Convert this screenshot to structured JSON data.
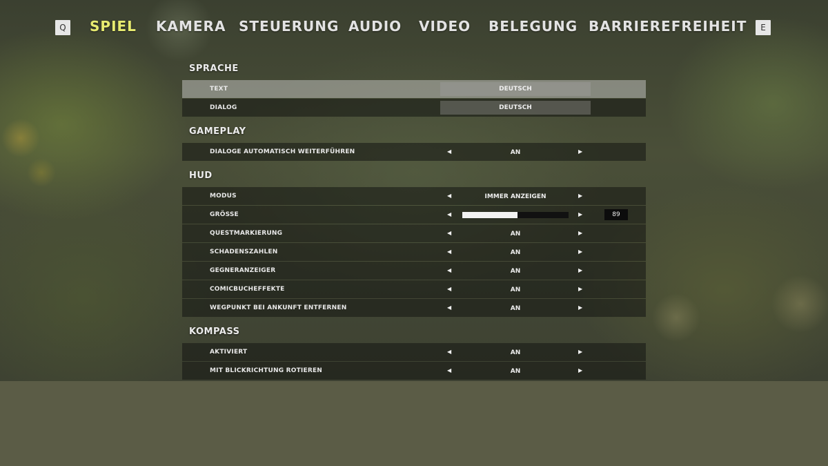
{
  "nav": {
    "prev_key": "Q",
    "next_key": "E",
    "tabs": [
      {
        "label": "Spiel",
        "active": true
      },
      {
        "label": "Kamera"
      },
      {
        "label": "Steuerung"
      },
      {
        "label": "Audio"
      },
      {
        "label": "Video"
      },
      {
        "label": "Belegung"
      },
      {
        "label": "Barrierefreiheit"
      }
    ]
  },
  "colors": {
    "active_tab": "#e8ec70",
    "text": "#e3e3e3"
  },
  "sections": {
    "sprache": {
      "title": "Sprache",
      "text": {
        "label": "Text",
        "value": "Deutsch"
      },
      "dialog": {
        "label": "Dialog",
        "value": "Deutsch"
      }
    },
    "gameplay": {
      "title": "Gameplay",
      "auto_dialog": {
        "label": "Dialoge automatisch weiterführen",
        "value": "An"
      }
    },
    "hud": {
      "title": "HUD",
      "modus": {
        "label": "Modus",
        "value": "Immer anzeigen"
      },
      "groesse": {
        "label": "Größe",
        "value": "89",
        "fraction": 0.52
      },
      "questmarkierung": {
        "label": "Questmarkierung",
        "value": "An"
      },
      "schadenszahlen": {
        "label": "Schadenszahlen",
        "value": "An"
      },
      "gegneranzeiger": {
        "label": "Gegneranzeiger",
        "value": "An"
      },
      "comicbucheffekte": {
        "label": "Comicbucheffekte",
        "value": "An"
      },
      "wegpunkt": {
        "label": "Wegpunkt bei Ankunft entfernen",
        "value": "An"
      }
    },
    "kompass": {
      "title": "Kompass",
      "aktiviert": {
        "label": "Aktiviert",
        "value": "An"
      },
      "rotieren": {
        "label": "Mit Blickrichtung rotieren",
        "value": "An"
      }
    }
  },
  "icons": {
    "left_arrow": "◀",
    "right_arrow": "▶"
  }
}
